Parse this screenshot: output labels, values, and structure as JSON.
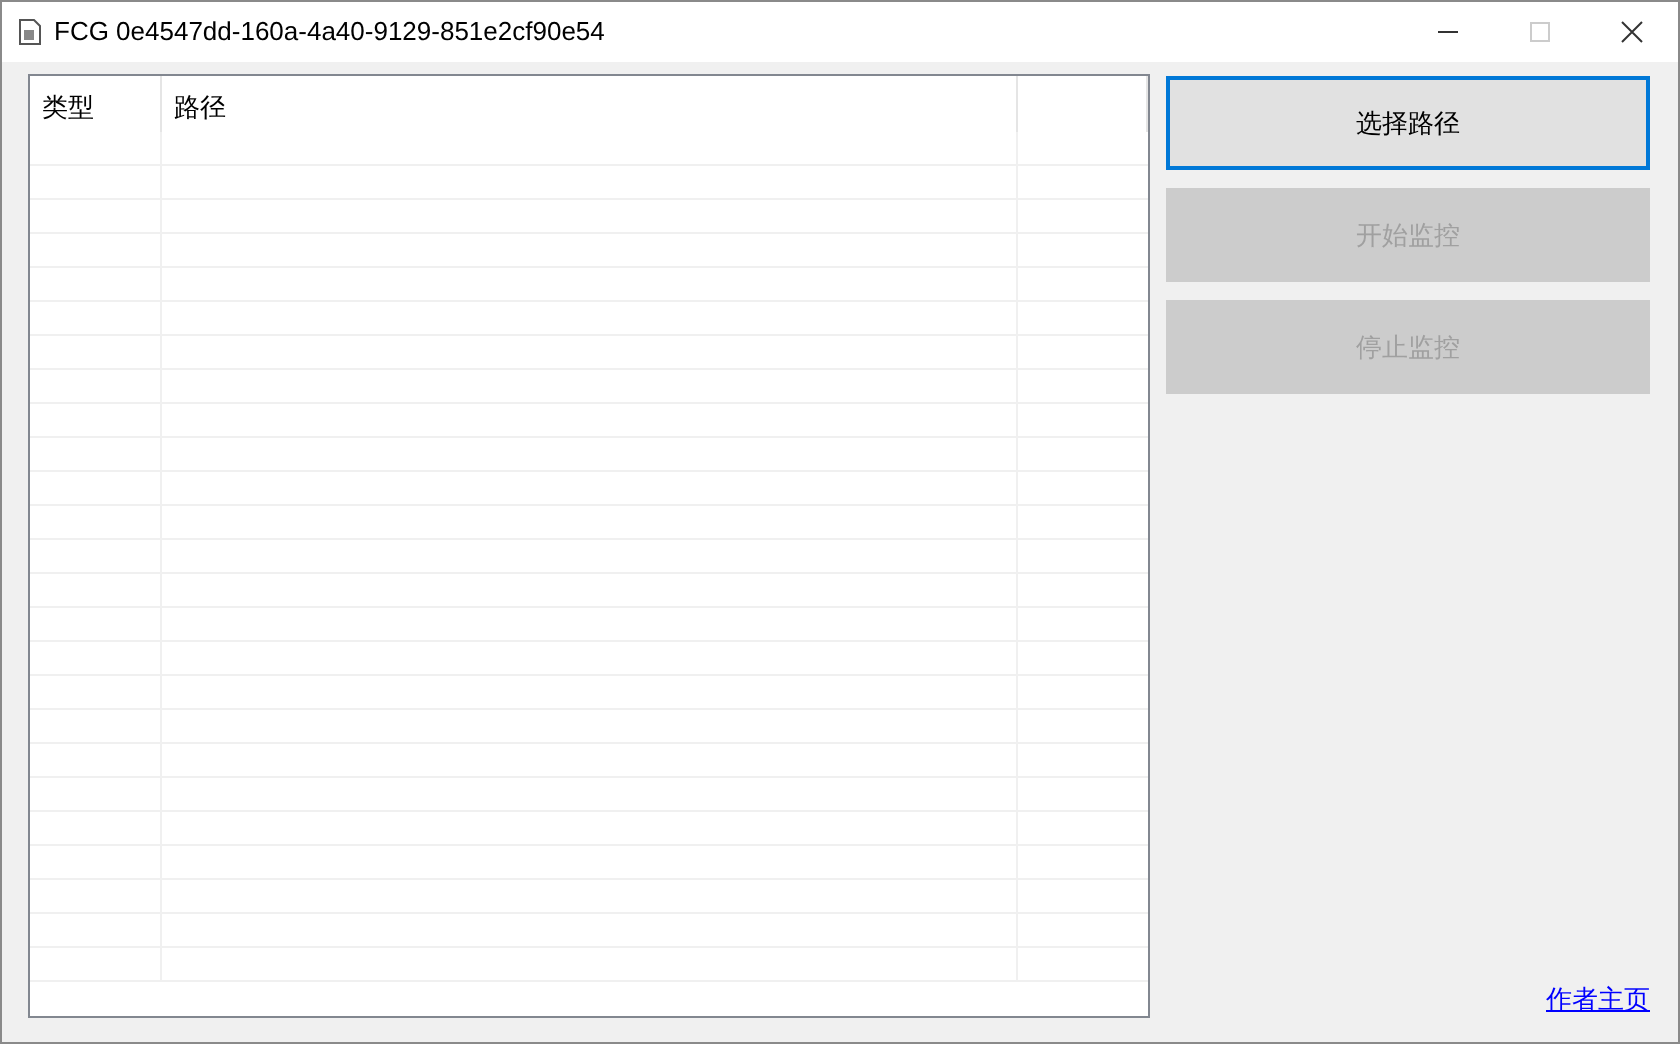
{
  "window": {
    "title": "FCG 0e4547dd-160a-4a40-9129-851e2cf90e54"
  },
  "list": {
    "columns": [
      "类型",
      "路径"
    ]
  },
  "buttons": [
    {
      "label": "选择路径",
      "disabled": false,
      "focused": true
    },
    {
      "label": "开始监控",
      "disabled": true,
      "focused": false
    },
    {
      "label": "停止监控",
      "disabled": true,
      "focused": false
    }
  ],
  "link": "作者主页"
}
